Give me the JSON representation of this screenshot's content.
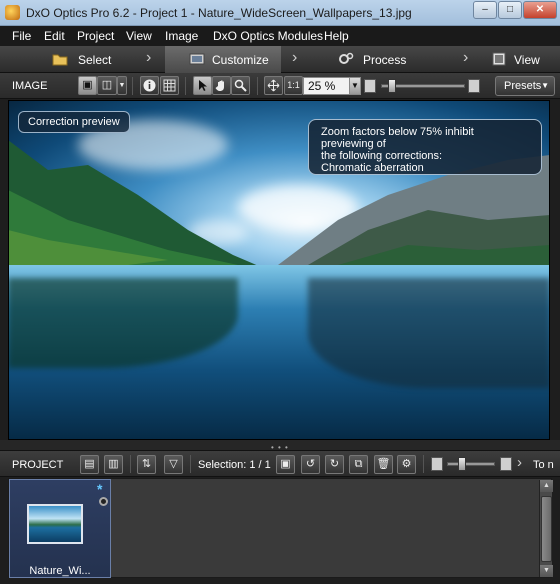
{
  "window": {
    "title": "DxO Optics Pro 6.2 - Project 1 - Nature_WideScreen_Wallpapers_13.jpg"
  },
  "menu": {
    "items": [
      "File",
      "Edit",
      "Project",
      "View",
      "Image",
      "DxO Optics Modules",
      "Help"
    ]
  },
  "steps": {
    "select": "Select",
    "customize": "Customize",
    "process": "Process",
    "view": "View"
  },
  "image_toolbar": {
    "label": "IMAGE",
    "zoom_value": "25 %",
    "presets_label": "Presets"
  },
  "viewer": {
    "badge": "Correction preview",
    "message_line1": "Zoom factors below 75% inhibit previewing of",
    "message_line2": "the following corrections:",
    "message_line3": "Chromatic aberration"
  },
  "project_bar": {
    "label": "PROJECT",
    "selection": "Selection: 1 / 1",
    "trailing": "To n"
  },
  "thumbnail": {
    "name": "Nature_Wi...",
    "star": "*"
  },
  "colors": {
    "active_tab": "#5a5a5a",
    "title_bar": "#a3bfdc",
    "accent_star": "#66c8ff"
  }
}
